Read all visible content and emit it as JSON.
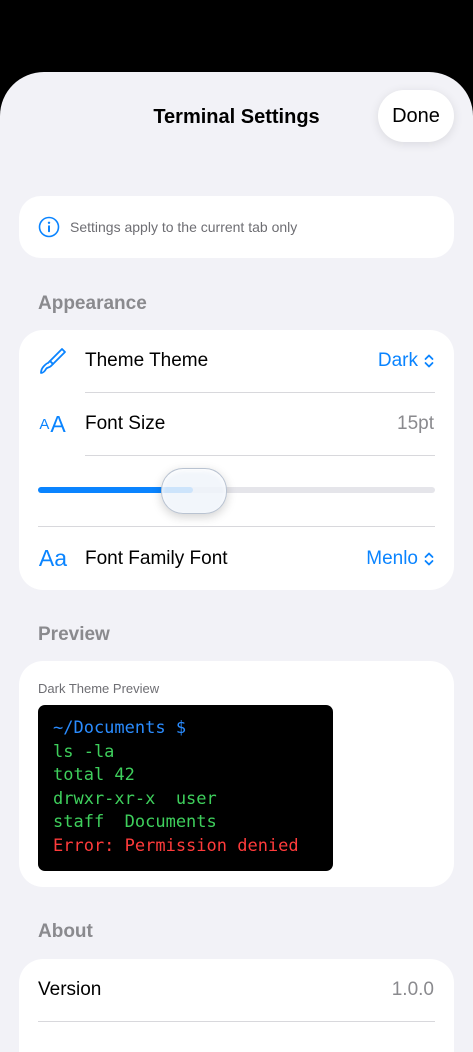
{
  "nav": {
    "title": "Terminal Settings",
    "done_label": "Done"
  },
  "info": {
    "icon": "info-circle-icon",
    "text": "Settings apply to the current tab only"
  },
  "appearance": {
    "header": "Appearance",
    "theme": {
      "icon": "paintbrush-icon",
      "label": "Theme  Theme",
      "value": "Dark"
    },
    "font_size": {
      "icon": "text-size-icon",
      "icon_text": "AA",
      "label": "Font Size",
      "value": "15pt",
      "slider_fraction": 0.39
    },
    "font_family": {
      "icon": "text-font-icon",
      "icon_text": "Aa",
      "label": "Font Family  Font",
      "value": "Menlo"
    }
  },
  "preview": {
    "header": "Preview",
    "caption": "Dark Theme Preview",
    "lines": [
      {
        "text": "~/Documents $",
        "color": "#2a8cff"
      },
      {
        "text": "ls -la",
        "color": "#3ecf5c"
      },
      {
        "text": "total 42",
        "color": "#3ecf5c"
      },
      {
        "text": "drwxr-xr-x  user",
        "color": "#3ecf5c"
      },
      {
        "text": "staff  Documents",
        "color": "#3ecf5c"
      },
      {
        "text": "Error: Permission denied",
        "color": "#ff3b3b"
      }
    ]
  },
  "about": {
    "header": "About",
    "version": {
      "label": "Version",
      "value": "1.0.0"
    }
  },
  "colors": {
    "accent": "#0a84ff",
    "background": "#f2f2f7",
    "terminal_bg": "#000000"
  }
}
